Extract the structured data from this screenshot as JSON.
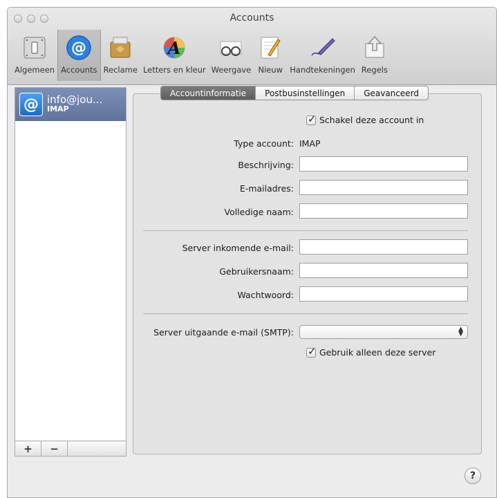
{
  "window": {
    "title": "Accounts"
  },
  "toolbar": {
    "items": [
      {
        "label": "Algemeen",
        "icon": "switch-icon"
      },
      {
        "label": "Accounts",
        "icon": "at-icon"
      },
      {
        "label": "Reclame",
        "icon": "trash-bin-icon"
      },
      {
        "label": "Letters en kleur",
        "icon": "font-color-icon"
      },
      {
        "label": "Weergave",
        "icon": "glasses-icon"
      },
      {
        "label": "Nieuw",
        "icon": "compose-icon"
      },
      {
        "label": "Handtekeningen",
        "icon": "pen-icon"
      },
      {
        "label": "Regels",
        "icon": "rules-icon"
      }
    ],
    "selected": "Accounts"
  },
  "sidebar": {
    "account": {
      "name": "info@jou...",
      "type": "IMAP",
      "icon_glyph": "@"
    },
    "add_label": "+",
    "remove_label": "−"
  },
  "tabs": [
    {
      "label": "Accountinformatie",
      "active": true
    },
    {
      "label": "Postbusinstellingen",
      "active": false
    },
    {
      "label": "Geavanceerd",
      "active": false
    }
  ],
  "form": {
    "enable_account_label": "Schakel deze account in",
    "enable_account_checked": true,
    "type_label": "Type account:",
    "type_value": "IMAP",
    "description_label": "Beschrijving:",
    "description_value": "",
    "email_label": "E-mailadres:",
    "email_value": "",
    "fullname_label": "Volledige naam:",
    "fullname_value": "",
    "incoming_label": "Server inkomende e-mail:",
    "incoming_value": "",
    "username_label": "Gebruikersnaam:",
    "username_value": "",
    "password_label": "Wachtwoord:",
    "password_value": "",
    "smtp_label": "Server uitgaande e-mail (SMTP):",
    "smtp_value": "",
    "only_server_label": "Gebruik alleen deze server",
    "only_server_checked": true
  },
  "help": {
    "glyph": "?"
  },
  "colors": {
    "selection": "#6b7ea8",
    "tab_active": "#6a6a6a",
    "accent_blue": "#2e7fde"
  }
}
